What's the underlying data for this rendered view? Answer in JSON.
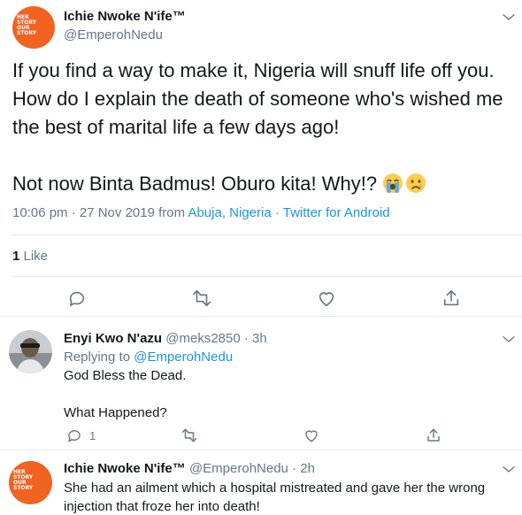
{
  "main_tweet": {
    "display_name": "Ichie Nwoke N'ife™",
    "handle": "@EmperohNedu",
    "avatar_text": [
      "HER",
      "STORY",
      "OUR",
      "STORY"
    ],
    "body_line1": "If you find a way to make it, Nigeria will snuff life off you. How do I explain the death of someone who's wished me the best of marital life a few days ago!",
    "body_line2": "Not now Binta Badmus! Oburo kita! Why!?",
    "emojis": [
      "loudly-crying-face-emoji",
      "crying-face-emoji"
    ],
    "time": "10:06 pm · 27 Nov 2019 from ",
    "location": "Abuja, Nigeria",
    "separator": " · ",
    "client": "Twitter for Android",
    "like_count": "1",
    "like_label": " Like",
    "actions": [
      "reply-icon",
      "retweet-icon",
      "like-icon",
      "share-icon"
    ]
  },
  "replies": [
    {
      "display_name": "Enyi Kwo N'azu",
      "handle_time": " @meks2850 · 3h",
      "replying_to_label": "Replying to ",
      "replying_to_handle": "@EmperohNedu",
      "text": "God Bless the Dead.\n\nWhat Happened?",
      "reply_count": "1"
    },
    {
      "display_name": "Ichie Nwoke N'ife™",
      "handle_time": " @EmperohNedu · 2h",
      "text": "She had an ailment which a hospital mistreated and gave her the wrong injection that froze her into death!"
    }
  ],
  "colors": {
    "accent": "#1b95e0",
    "secondary_text": "#657786",
    "avatar_brand": "#f26322"
  }
}
